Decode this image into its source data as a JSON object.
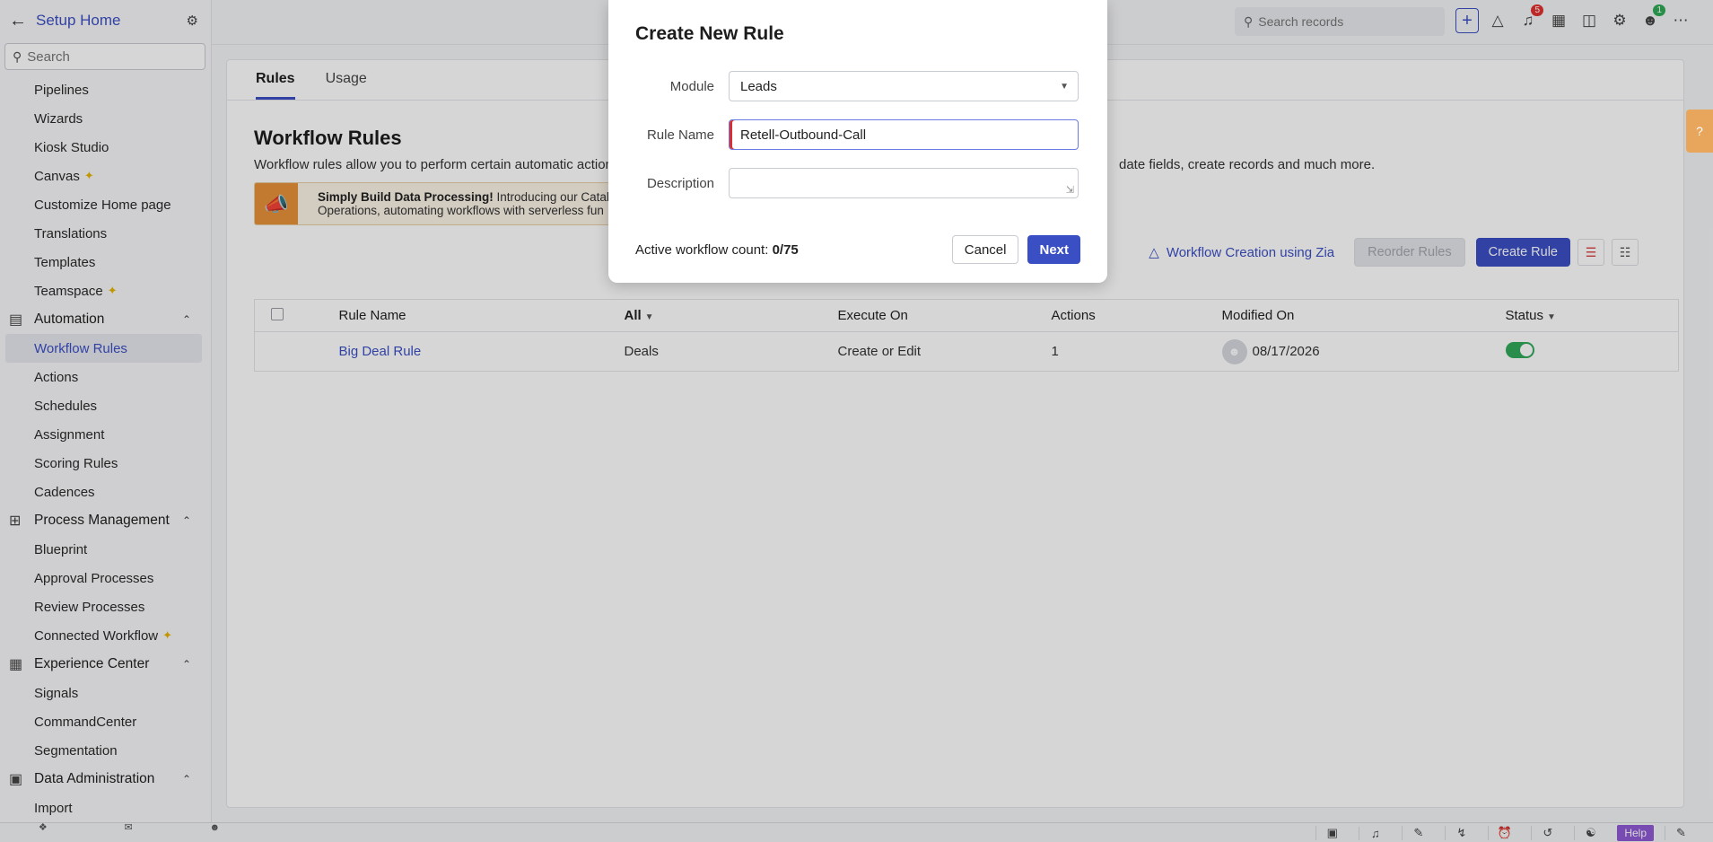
{
  "sidebar": {
    "title": "Setup Home",
    "search_placeholder": "Search",
    "items_top": [
      {
        "label": "Pipelines"
      },
      {
        "label": "Wizards"
      },
      {
        "label": "Kiosk Studio"
      },
      {
        "label": "Canvas"
      },
      {
        "label": "Customize Home page"
      },
      {
        "label": "Translations"
      },
      {
        "label": "Templates"
      },
      {
        "label": "Teamspace"
      }
    ],
    "groups": [
      {
        "label": "Automation",
        "items": [
          "Workflow Rules",
          "Actions",
          "Schedules",
          "Assignment",
          "Scoring Rules",
          "Cadences"
        ]
      },
      {
        "label": "Process Management",
        "items": [
          "Blueprint",
          "Approval Processes",
          "Review Processes",
          "Connected Workflow"
        ]
      },
      {
        "label": "Experience Center",
        "items": [
          "Signals",
          "CommandCenter",
          "Segmentation"
        ]
      },
      {
        "label": "Data Administration",
        "items": [
          "Import"
        ]
      }
    ]
  },
  "topbar": {
    "search_placeholder": "Search records",
    "notification_count": "5",
    "status_badge": "1"
  },
  "main": {
    "tabs": [
      "Rules",
      "Usage"
    ],
    "title": "Workflow Rules",
    "desc_part1": "Workflow rules allow you to perform certain automatic action",
    "desc_part2": "date fields, create records and much more.",
    "promo_bold": "Simply Build Data Processing!",
    "promo_text": " Introducing our Cataly",
    "promo_line2": "Operations, automating workflows with serverless fun",
    "zia_link": "Workflow Creation using Zia",
    "reorder_button": "Reorder Rules",
    "create_button": "Create Rule",
    "table": {
      "headers": [
        "Rule Name",
        "All",
        "Execute On",
        "Actions",
        "Modified On",
        "Status"
      ],
      "rows": [
        {
          "name": "Big Deal Rule",
          "module": "Deals",
          "execute_on": "Create or Edit",
          "actions": "1",
          "modified_on": "08/17/2026",
          "status": "on"
        }
      ]
    }
  },
  "modal": {
    "title": "Create New Rule",
    "module_label": "Module",
    "module_value": "Leads",
    "rule_name_label": "Rule Name",
    "rule_name_value": "Retell-Outbound-Call",
    "description_label": "Description",
    "description_value": "",
    "count_label": "Active workflow count: ",
    "count_value": "0/75",
    "cancel_button": "Cancel",
    "next_button": "Next"
  },
  "bottombar": {
    "help_label": "Help"
  },
  "colors": {
    "accent": "#3b4fc4",
    "toggle_on": "#31a95a",
    "badge": "#e0322f",
    "help": "#8f5ad6"
  }
}
